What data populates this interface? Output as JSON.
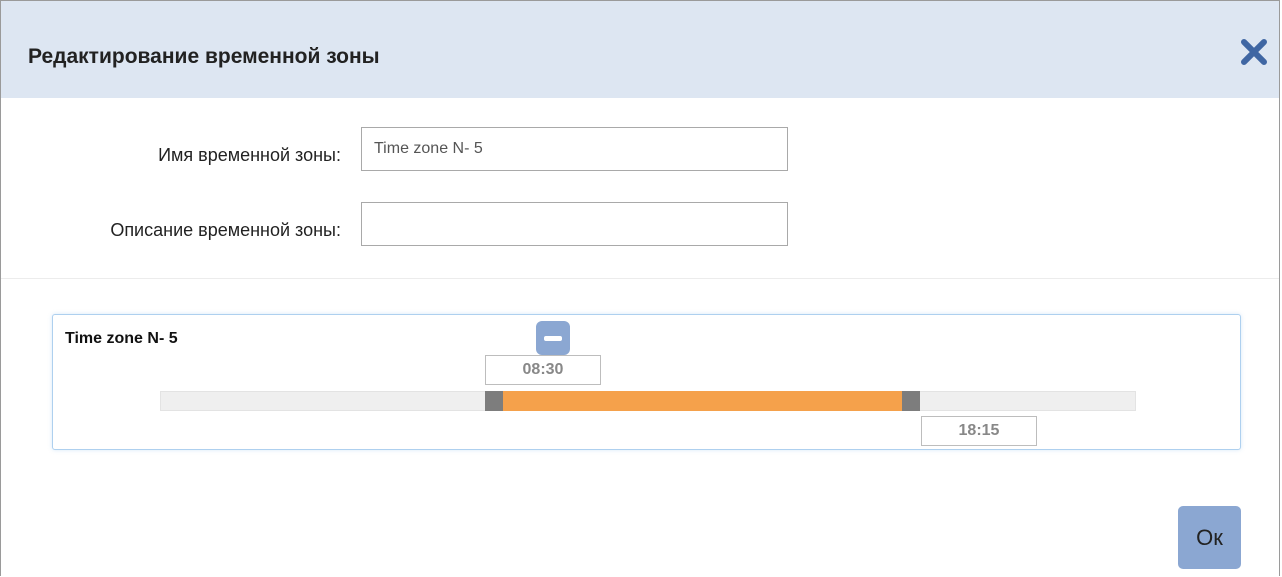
{
  "dialog": {
    "title": "Редактирование временной зоны",
    "close_icon": "close-x-icon",
    "header_color": "#dde6f2"
  },
  "form": {
    "name_label": "Имя временной зоны:",
    "name_value": "Time zone N- 5",
    "description_label": "Описание временной зоны:",
    "description_value": ""
  },
  "zone": {
    "title": "Time zone N- 5",
    "remove_icon": "minus-icon",
    "start_time": "08:30",
    "end_time": "18:15",
    "range_color": "#f5a14b"
  },
  "footer": {
    "ok_label": "Ок",
    "button_color": "#8ba7d2"
  }
}
